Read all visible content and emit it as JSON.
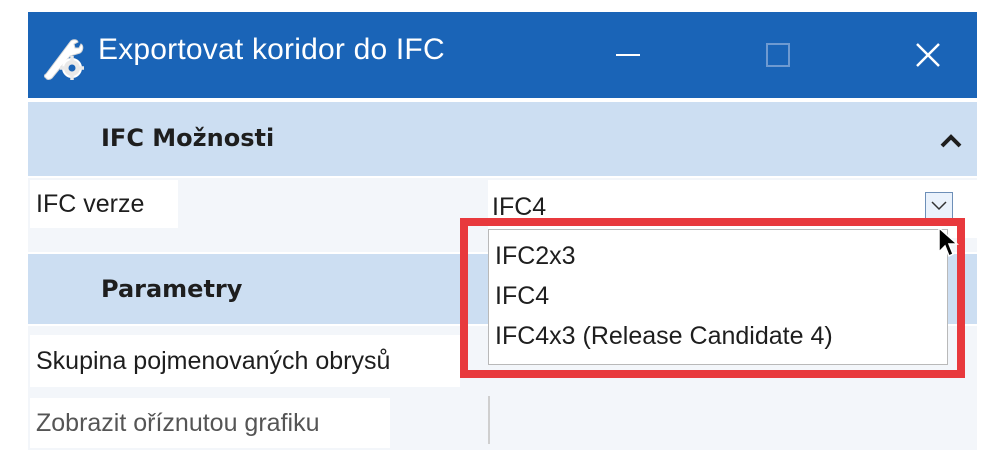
{
  "window": {
    "title": "Exportovat koridor do IFC",
    "icon": "export-gear-icon",
    "title_bar_color": "#1a64b7"
  },
  "sections": {
    "ifc_options": {
      "title": "IFC Možnosti",
      "collapse_icon": "chevron-up-icon",
      "header_color": "#ccdef2"
    },
    "parameters": {
      "title": "Parametry"
    }
  },
  "ifc_version": {
    "label": "IFC verze",
    "value": "IFC4",
    "options": [
      "IFC2x3",
      "IFC4",
      "IFC4x3 (Release Candidate 4)"
    ]
  },
  "parameters": {
    "named_boundary_group_label": "Skupina pojmenovaných obrysů",
    "show_clipped_graphics_label": "Zobrazit oříznutou grafiku"
  },
  "annotation": {
    "highlight_color": "#e8393d"
  }
}
